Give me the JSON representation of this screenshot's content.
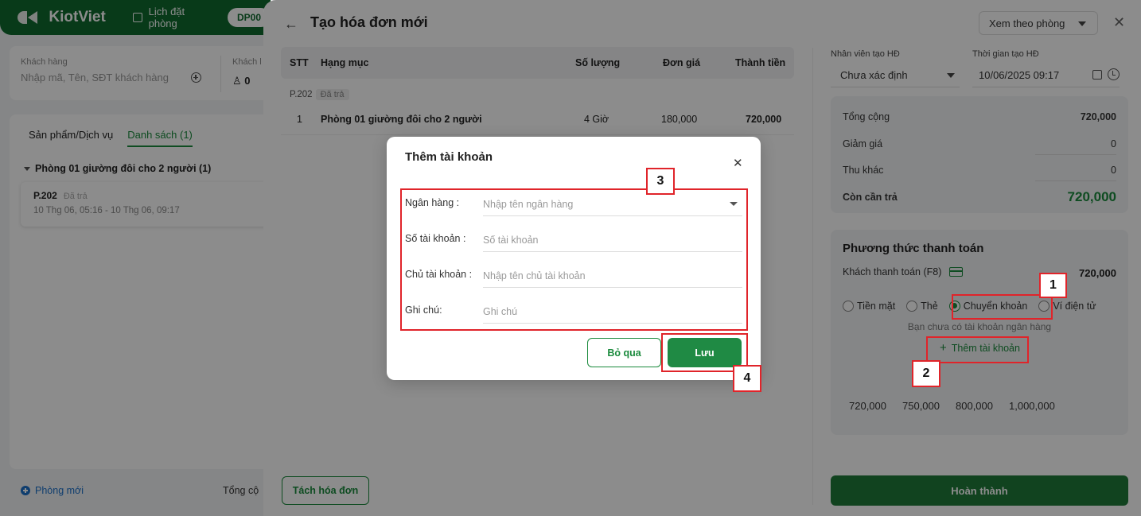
{
  "app": {
    "brand": "KiotViet",
    "top_link": "Lịch đặt phòng",
    "top_pill": "DP00"
  },
  "left": {
    "customer_label": "Khách hàng",
    "customer_placeholder": "Nhập mã, Tên, SĐT khách hàng",
    "guest_label": "Khách l",
    "guest_count": "0",
    "tabs": [
      "Sản phẩm/Dịch vụ",
      "Danh sách (1)"
    ],
    "group": "Phòng 01 giường đôi cho 2 người (1)",
    "room_code": "P.202",
    "room_status": "Đã trả",
    "room_time": "10 Thg 06, 05:16 - 10 Thg 06, 09:17",
    "new_room": "Phòng mới",
    "total_label": "Tổng cộ"
  },
  "drawer": {
    "title": "Tạo hóa đơn mới",
    "view_select": "Xem theo phòng",
    "columns": [
      "STT",
      "Hạng mục",
      "Số lượng",
      "Đơn giá",
      "Thành tiền"
    ],
    "group_code": "P.202",
    "group_status": "Đã trả",
    "row": {
      "stt": "1",
      "item": "Phòng 01 giường đôi cho 2 người",
      "qty": "4 Giờ",
      "price": "180,000",
      "total": "720,000"
    },
    "split_btn": "Tách hóa đơn",
    "emp_label": "Nhân viên tạo HĐ",
    "emp_value": "Chưa xác định",
    "time_label": "Thời gian tạo HĐ",
    "time_value": "10/06/2025 09:17",
    "summary": {
      "total_k": "Tổng cộng",
      "total_v": "720,000",
      "discount_k": "Giảm giá",
      "discount_v": "0",
      "other_k": "Thu khác",
      "other_v": "0",
      "due_k": "Còn cần trả",
      "due_v": "720,000"
    },
    "payment": {
      "title": "Phương thức thanh toán",
      "customer_pays": "Khách thanh toán (F8)",
      "amount": "720,000",
      "methods": [
        "Tiền mặt",
        "Thẻ",
        "Chuyển khoản",
        "Ví điện tử"
      ],
      "selected": "Chuyển khoản",
      "no_account": "Bạn chưa có tài khoản ngân hàng",
      "add_account": "Thêm tài khoản",
      "quick": [
        "720,000",
        "750,000",
        "800,000",
        "1,000,000"
      ]
    },
    "done_btn": "Hoàn thành"
  },
  "modal": {
    "title": "Thêm tài khoản",
    "fields": [
      {
        "label": "Ngân hàng :",
        "placeholder": "Nhập tên ngân hàng"
      },
      {
        "label": "Số tài khoản :",
        "placeholder": "Số tài khoản"
      },
      {
        "label": "Chủ tài khoản :",
        "placeholder": "Nhập tên chủ tài khoản"
      },
      {
        "label": "Ghi chú:",
        "placeholder": "Ghi chú"
      }
    ],
    "skip_btn": "Bỏ qua",
    "save_btn": "Lưu"
  },
  "annotations": [
    "1",
    "2",
    "3",
    "4"
  ],
  "colors": {
    "brand_green": "#0f6b2f",
    "accent_green": "#1a8a3c",
    "annotation_red": "#e0242a"
  }
}
